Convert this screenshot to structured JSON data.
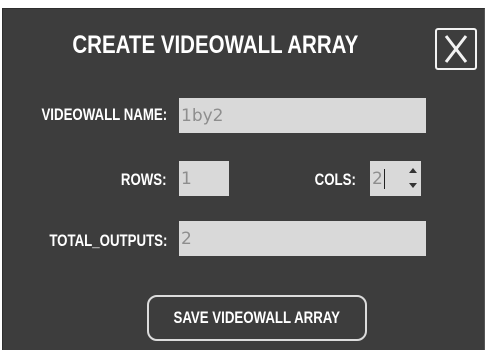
{
  "dialog": {
    "title": "CREATE VIDEOWALL ARRAY",
    "close_label": "X"
  },
  "form": {
    "name_label": "VIDEOWALL NAME:",
    "name_value": "1by2",
    "rows_label": "ROWS:",
    "rows_value": "1",
    "cols_label": "COLS:",
    "cols_value": "2",
    "total_label": "TOTAL_OUTPUTS:",
    "total_value": "2"
  },
  "actions": {
    "save_label": "SAVE VIDEOWALL ARRAY"
  },
  "icons": {
    "close": "close-icon",
    "stepper_up": "chevron-up-icon",
    "stepper_down": "chevron-down-icon"
  },
  "colors": {
    "dialog_background": "#3d3d3d",
    "field_background": "#d9d9d9",
    "field_text": "#8e8e8e",
    "text": "#ffffff"
  }
}
